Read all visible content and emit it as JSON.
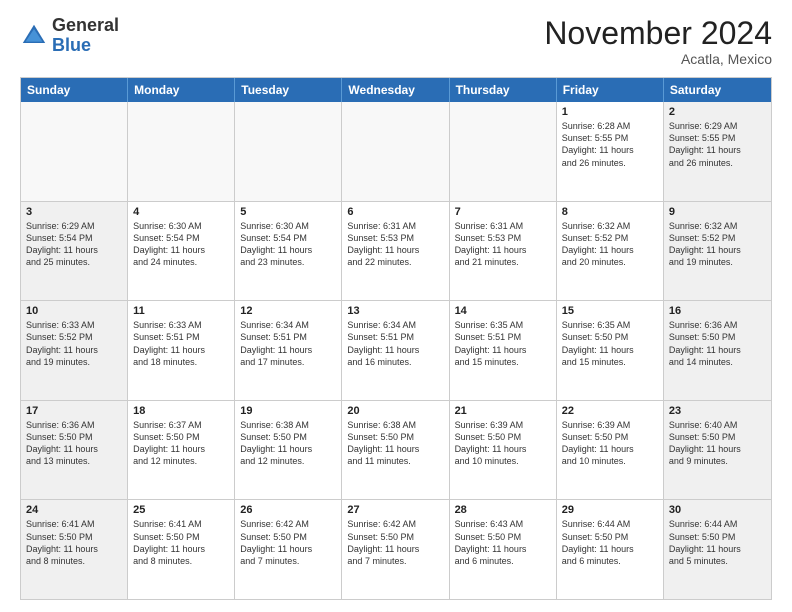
{
  "logo": {
    "general": "General",
    "blue": "Blue"
  },
  "header": {
    "month": "November 2024",
    "location": "Acatla, Mexico"
  },
  "weekdays": [
    "Sunday",
    "Monday",
    "Tuesday",
    "Wednesday",
    "Thursday",
    "Friday",
    "Saturday"
  ],
  "rows": [
    [
      {
        "day": "",
        "info": ""
      },
      {
        "day": "",
        "info": ""
      },
      {
        "day": "",
        "info": ""
      },
      {
        "day": "",
        "info": ""
      },
      {
        "day": "",
        "info": ""
      },
      {
        "day": "1",
        "info": "Sunrise: 6:28 AM\nSunset: 5:55 PM\nDaylight: 11 hours\nand 26 minutes."
      },
      {
        "day": "2",
        "info": "Sunrise: 6:29 AM\nSunset: 5:55 PM\nDaylight: 11 hours\nand 26 minutes."
      }
    ],
    [
      {
        "day": "3",
        "info": "Sunrise: 6:29 AM\nSunset: 5:54 PM\nDaylight: 11 hours\nand 25 minutes."
      },
      {
        "day": "4",
        "info": "Sunrise: 6:30 AM\nSunset: 5:54 PM\nDaylight: 11 hours\nand 24 minutes."
      },
      {
        "day": "5",
        "info": "Sunrise: 6:30 AM\nSunset: 5:54 PM\nDaylight: 11 hours\nand 23 minutes."
      },
      {
        "day": "6",
        "info": "Sunrise: 6:31 AM\nSunset: 5:53 PM\nDaylight: 11 hours\nand 22 minutes."
      },
      {
        "day": "7",
        "info": "Sunrise: 6:31 AM\nSunset: 5:53 PM\nDaylight: 11 hours\nand 21 minutes."
      },
      {
        "day": "8",
        "info": "Sunrise: 6:32 AM\nSunset: 5:52 PM\nDaylight: 11 hours\nand 20 minutes."
      },
      {
        "day": "9",
        "info": "Sunrise: 6:32 AM\nSunset: 5:52 PM\nDaylight: 11 hours\nand 19 minutes."
      }
    ],
    [
      {
        "day": "10",
        "info": "Sunrise: 6:33 AM\nSunset: 5:52 PM\nDaylight: 11 hours\nand 19 minutes."
      },
      {
        "day": "11",
        "info": "Sunrise: 6:33 AM\nSunset: 5:51 PM\nDaylight: 11 hours\nand 18 minutes."
      },
      {
        "day": "12",
        "info": "Sunrise: 6:34 AM\nSunset: 5:51 PM\nDaylight: 11 hours\nand 17 minutes."
      },
      {
        "day": "13",
        "info": "Sunrise: 6:34 AM\nSunset: 5:51 PM\nDaylight: 11 hours\nand 16 minutes."
      },
      {
        "day": "14",
        "info": "Sunrise: 6:35 AM\nSunset: 5:51 PM\nDaylight: 11 hours\nand 15 minutes."
      },
      {
        "day": "15",
        "info": "Sunrise: 6:35 AM\nSunset: 5:50 PM\nDaylight: 11 hours\nand 15 minutes."
      },
      {
        "day": "16",
        "info": "Sunrise: 6:36 AM\nSunset: 5:50 PM\nDaylight: 11 hours\nand 14 minutes."
      }
    ],
    [
      {
        "day": "17",
        "info": "Sunrise: 6:36 AM\nSunset: 5:50 PM\nDaylight: 11 hours\nand 13 minutes."
      },
      {
        "day": "18",
        "info": "Sunrise: 6:37 AM\nSunset: 5:50 PM\nDaylight: 11 hours\nand 12 minutes."
      },
      {
        "day": "19",
        "info": "Sunrise: 6:38 AM\nSunset: 5:50 PM\nDaylight: 11 hours\nand 12 minutes."
      },
      {
        "day": "20",
        "info": "Sunrise: 6:38 AM\nSunset: 5:50 PM\nDaylight: 11 hours\nand 11 minutes."
      },
      {
        "day": "21",
        "info": "Sunrise: 6:39 AM\nSunset: 5:50 PM\nDaylight: 11 hours\nand 10 minutes."
      },
      {
        "day": "22",
        "info": "Sunrise: 6:39 AM\nSunset: 5:50 PM\nDaylight: 11 hours\nand 10 minutes."
      },
      {
        "day": "23",
        "info": "Sunrise: 6:40 AM\nSunset: 5:50 PM\nDaylight: 11 hours\nand 9 minutes."
      }
    ],
    [
      {
        "day": "24",
        "info": "Sunrise: 6:41 AM\nSunset: 5:50 PM\nDaylight: 11 hours\nand 8 minutes."
      },
      {
        "day": "25",
        "info": "Sunrise: 6:41 AM\nSunset: 5:50 PM\nDaylight: 11 hours\nand 8 minutes."
      },
      {
        "day": "26",
        "info": "Sunrise: 6:42 AM\nSunset: 5:50 PM\nDaylight: 11 hours\nand 7 minutes."
      },
      {
        "day": "27",
        "info": "Sunrise: 6:42 AM\nSunset: 5:50 PM\nDaylight: 11 hours\nand 7 minutes."
      },
      {
        "day": "28",
        "info": "Sunrise: 6:43 AM\nSunset: 5:50 PM\nDaylight: 11 hours\nand 6 minutes."
      },
      {
        "day": "29",
        "info": "Sunrise: 6:44 AM\nSunset: 5:50 PM\nDaylight: 11 hours\nand 6 minutes."
      },
      {
        "day": "30",
        "info": "Sunrise: 6:44 AM\nSunset: 5:50 PM\nDaylight: 11 hours\nand 5 minutes."
      }
    ]
  ]
}
